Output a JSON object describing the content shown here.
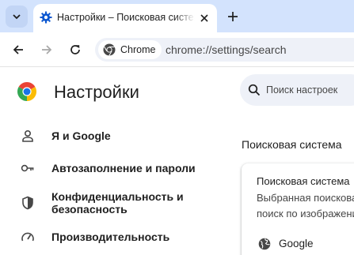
{
  "browser": {
    "tab": {
      "title": "Настройки – Поисковая система"
    },
    "omnibox": {
      "chip_label": "Chrome",
      "url": "chrome://settings/search"
    }
  },
  "settings": {
    "title": "Настройки",
    "search_placeholder": "Поиск настроек",
    "nav": [
      {
        "label": "Я и Google",
        "icon": "person-icon"
      },
      {
        "label": "Автозаполнение и пароли",
        "icon": "key-icon"
      },
      {
        "label": "Конфиденциальность и безопасность",
        "line1": "Конфиденциальность и",
        "line2": "безопасность",
        "icon": "shield-icon"
      },
      {
        "label": "Производительность",
        "icon": "speedometer-icon"
      }
    ],
    "section": {
      "title": "Поисковая система",
      "card_title": "Поисковая система",
      "card_desc_line1": "Выбранная поисковая",
      "card_desc_line2": "поиск по изображени",
      "engine": "Google"
    }
  },
  "colors": {
    "tabstrip": "#d3e3fd",
    "omnibox": "#eef1f8",
    "accent": "#0b57d0"
  }
}
